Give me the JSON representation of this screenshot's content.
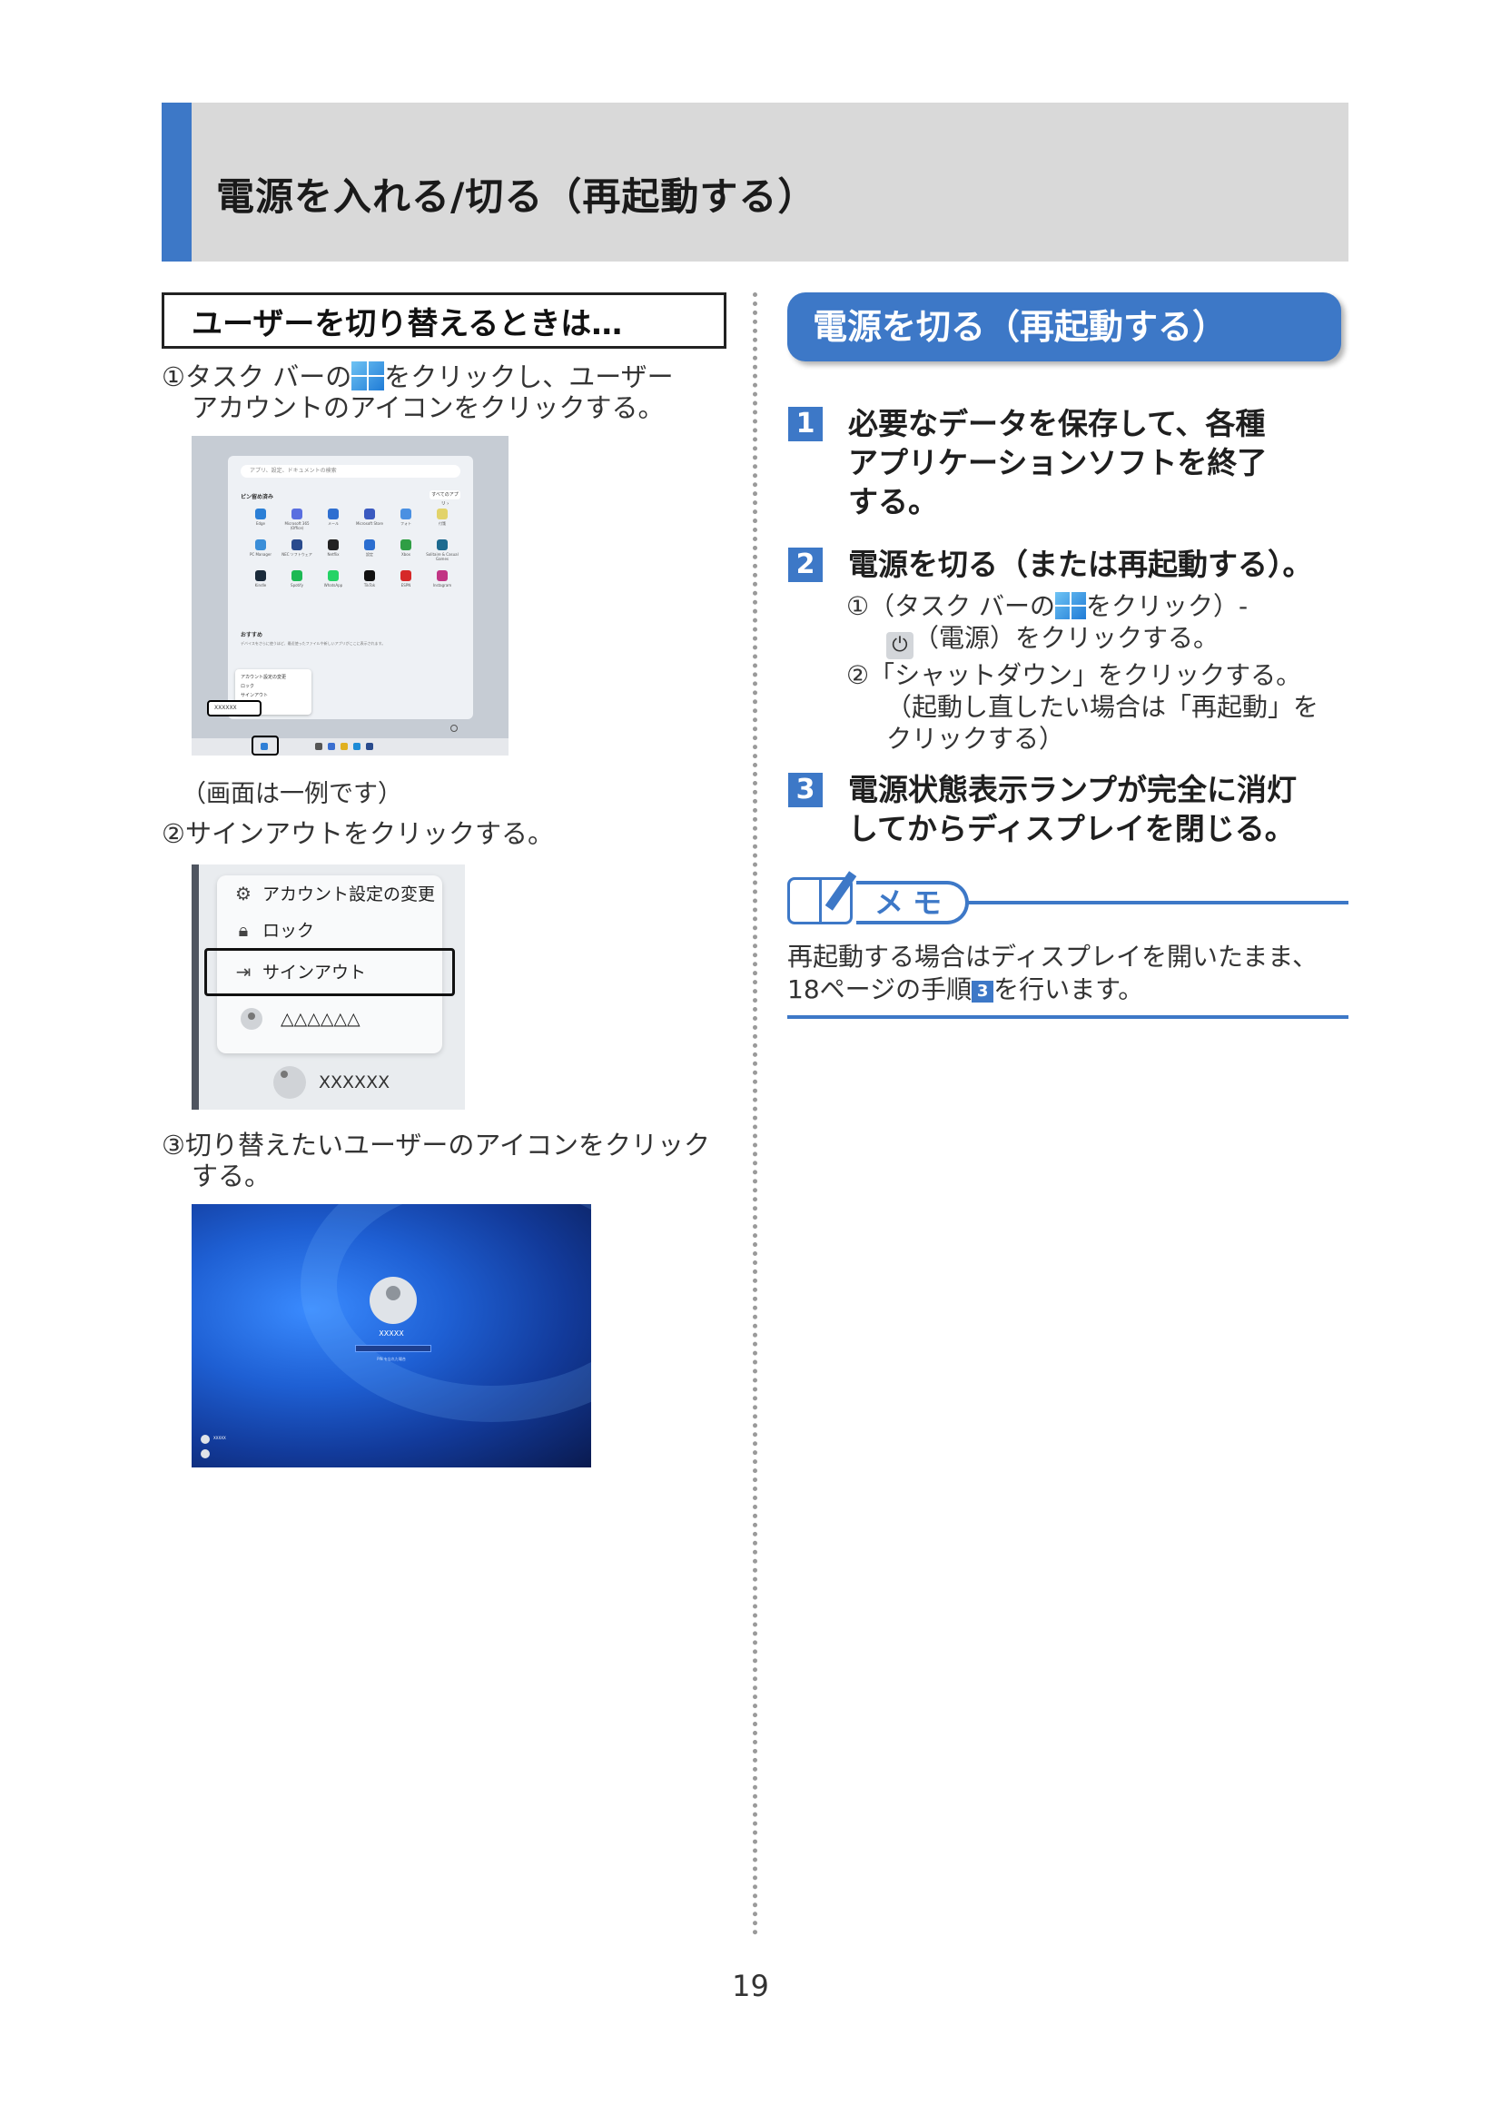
{
  "header": {
    "title": "電源を入れる/切る（再起動する）"
  },
  "left": {
    "box_heading": "ユーザーを切り替えるときは…",
    "step1": {
      "line1_a": "①タスク バーの",
      "line1_b": "をクリックし、ユーザー",
      "line2": "アカウントのアイコンをクリックする。"
    },
    "shot1": {
      "search_placeholder": "アプリ、設定、ドキュメントの検索",
      "pinned_label": "ピン留め済み",
      "all_apps_label": "すべてのアプリ ›",
      "apps": [
        "Edge",
        "Microsoft 365 (Office)",
        "メール",
        "Microsoft Store",
        "フォト",
        "付箋",
        "PC Manager",
        "NEC ソフトウェア",
        "Netflix",
        "設定",
        "Xbox",
        "Solitaire & Casual Games",
        "Kindle",
        "Spotify",
        "WhatsApp",
        "TikTok",
        "ESPN",
        "Instagram"
      ],
      "recommended_label": "おすすめ",
      "recommended_text": "デバイスをさらに使うほど、最近使ったファイルや新しいアプリがここに表示されます。",
      "popup_items": [
        "アカウント設定の変更",
        "ロック",
        "サインアウト",
        "△△△△△△"
      ],
      "account_name": "XXXXXX"
    },
    "caption": "（画面は一例です）",
    "step2": "②サインアウトをクリックする。",
    "shot2": {
      "change_account": "アカウント設定の変更",
      "lock": "ロック",
      "sign_out": "サインアウト",
      "other_user": "△△△△△△",
      "current_user": "XXXXXX"
    },
    "step3": {
      "line1": "③切り替えたいユーザーのアイコンをクリック",
      "line2": "する。"
    },
    "shot3": {
      "user_name": "XXXXX",
      "forgot_pin": "PIN を忘れた場合",
      "user1": "XXXXX"
    }
  },
  "right": {
    "pill_heading": "電源を切る（再起動する）",
    "steps": [
      {
        "num": "1",
        "lines": [
          "必要なデータを保存して、各種",
          "アプリケーションソフトを終了",
          "する。"
        ]
      },
      {
        "num": "2",
        "lines": [
          "電源を切る（または再起動する）。"
        ]
      },
      {
        "num": "3",
        "lines": [
          "電源状態表示ランプが完全に消灯",
          "してからディスプレイを閉じる。"
        ]
      }
    ],
    "step2_sub": {
      "l1_a": "①（タスク バーの",
      "l1_b": "をクリック）-",
      "l2_icon": "⏻",
      "l2_b": "（電源）をクリックする。",
      "l3": "②「シャットダウン」をクリックする。",
      "l4": "（起動し直したい場合は「再起動」を",
      "l5": "クリックする）"
    },
    "memo": {
      "label": "メモ",
      "line1": "再起動する場合はディスプレイを開いたまま、",
      "line2_a": "18ページの手順",
      "line2_num": "3",
      "line2_b": "を行います。"
    }
  },
  "page_number": "19",
  "colors": {
    "accent": "#3d78c7",
    "header_bg": "#d9d9d9"
  }
}
